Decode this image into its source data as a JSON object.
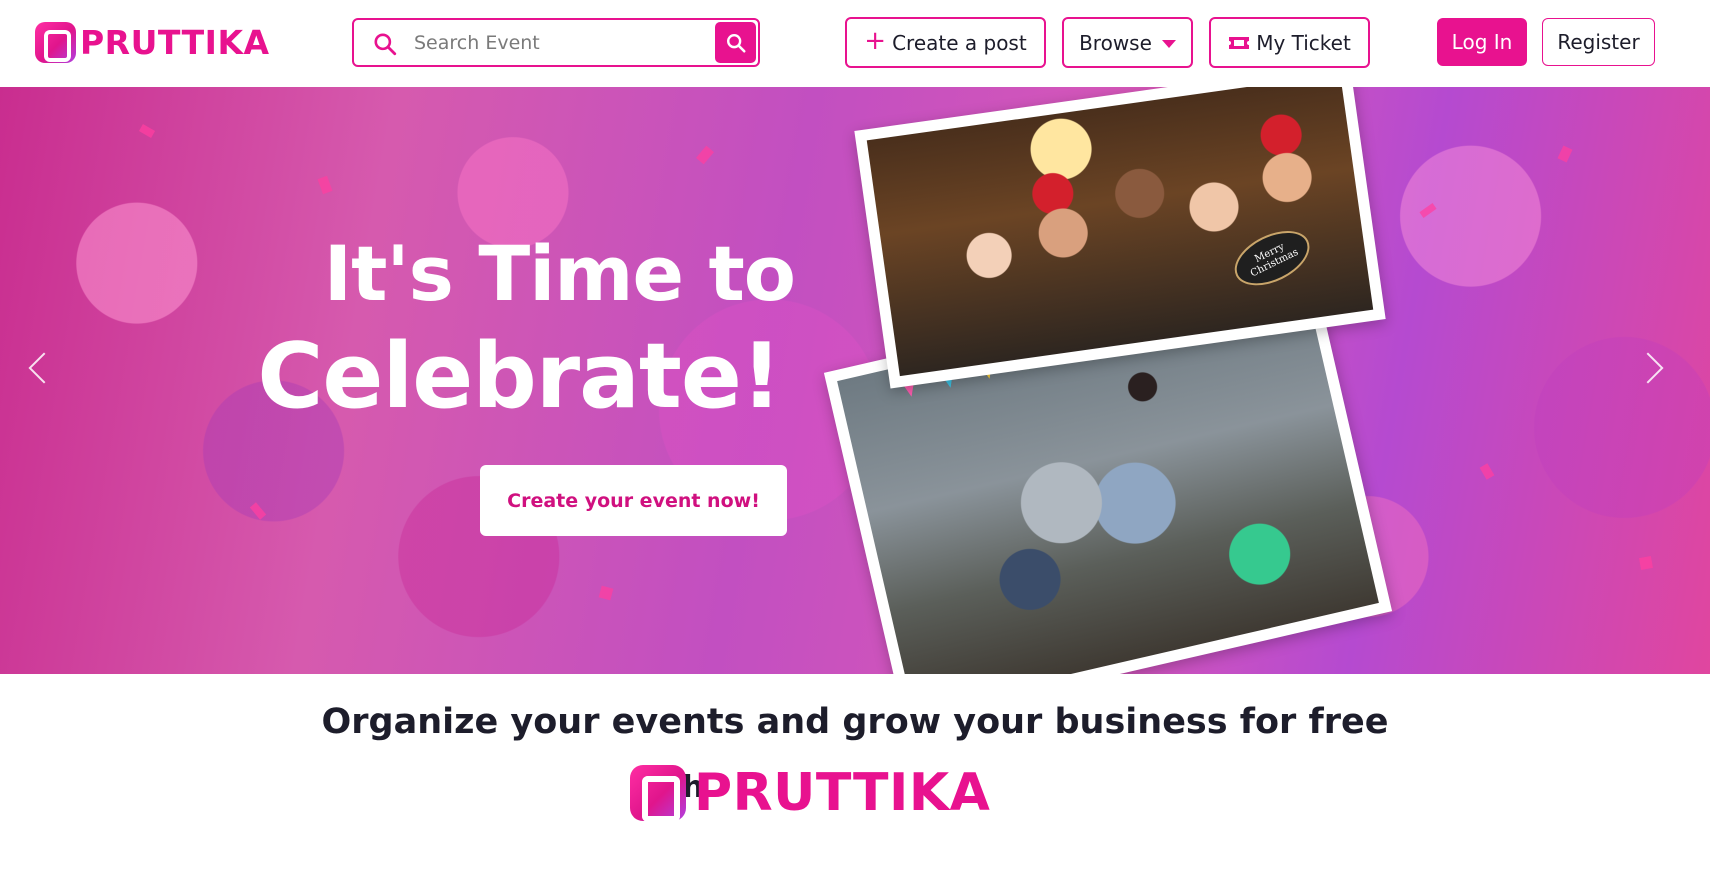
{
  "brand": {
    "name": "PRUTTIKA",
    "color": "#e8128f"
  },
  "header": {
    "search": {
      "placeholder": "Search Event",
      "icon": "search-icon"
    },
    "create_post_label": "Create a post",
    "browse_label": "Browse",
    "ticket_label": "My Ticket",
    "login_label": "Log In",
    "register_label": "Register"
  },
  "hero": {
    "title_line1": "It's Time to",
    "title_line2": "Celebrate!",
    "cta_label": "Create your event now!",
    "photo1_sign": "Merry Christmas"
  },
  "promo": {
    "tagline": "Organize your events and grow your business for free",
    "with_label": "with"
  }
}
